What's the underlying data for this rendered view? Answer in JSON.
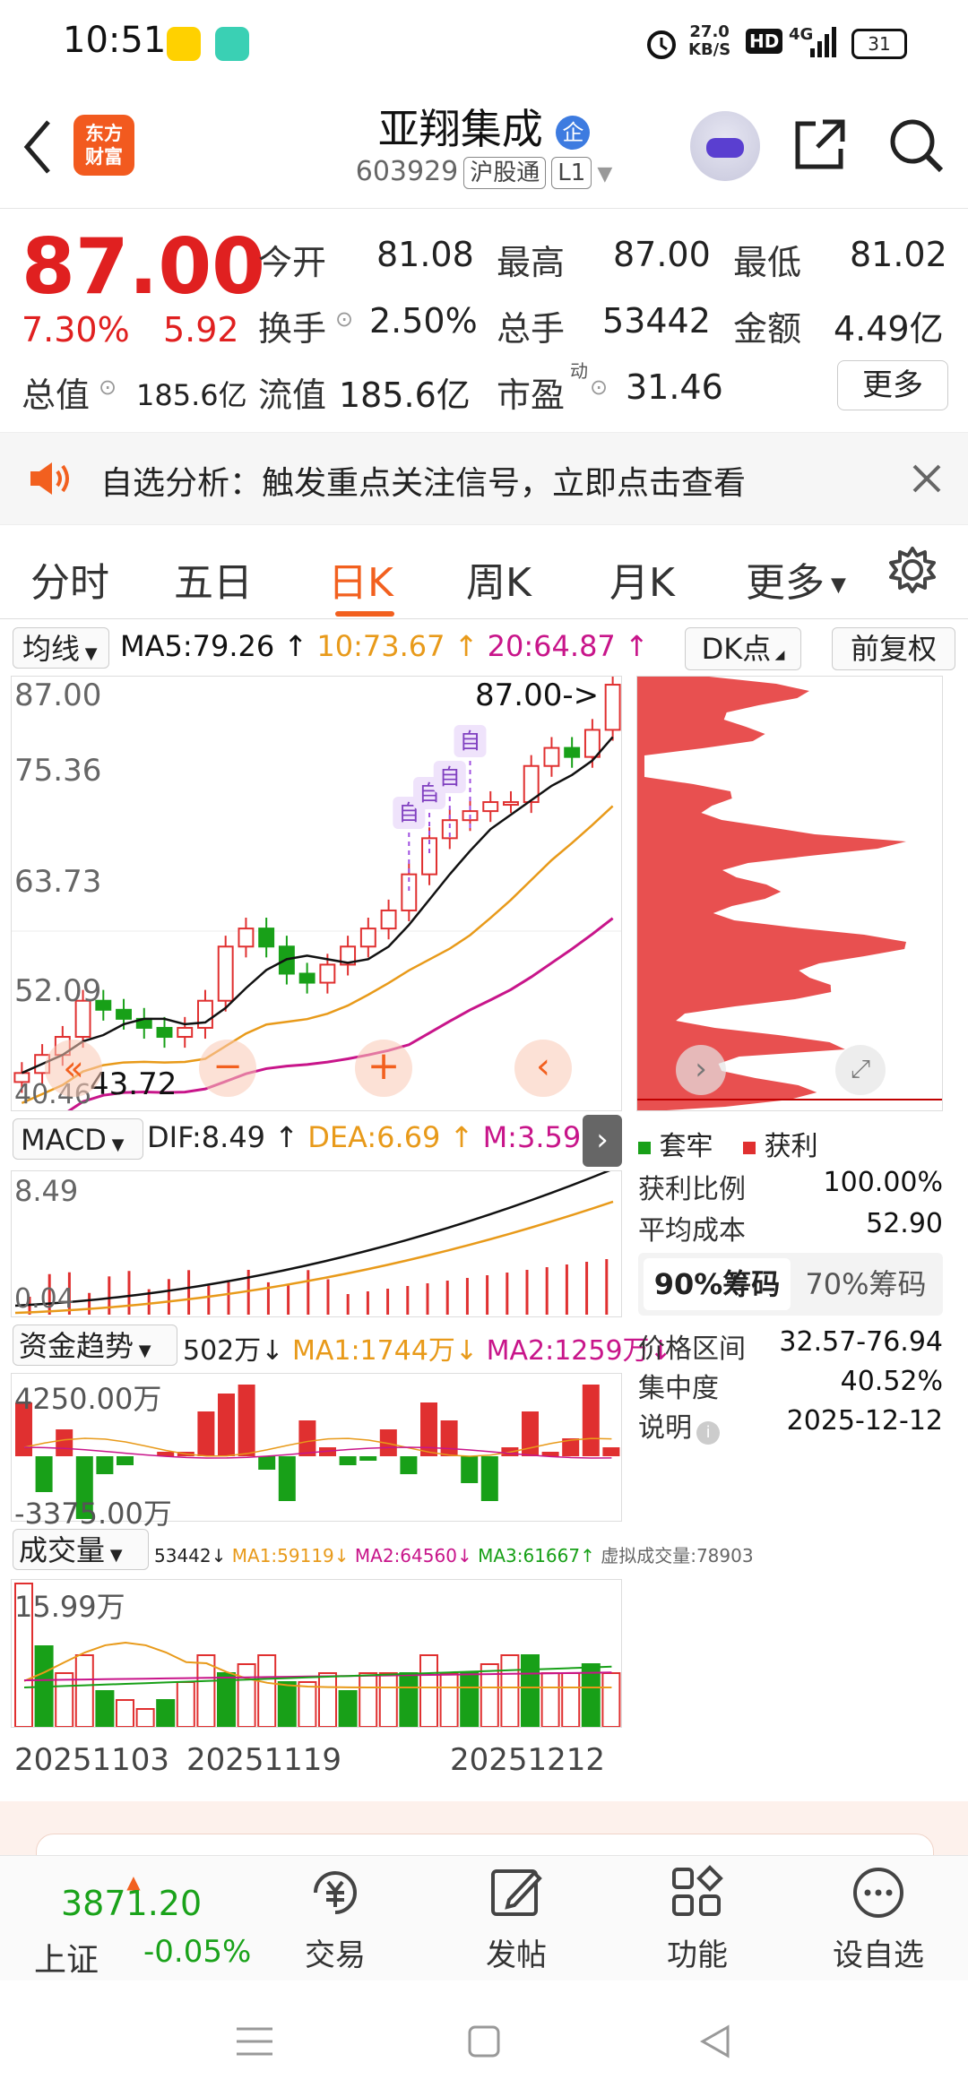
{
  "status": {
    "time": "10:51",
    "net_speed": "27.0\nKB/S",
    "net_speed_line1": "27.0",
    "net_speed_line2": "KB/S",
    "hd": "HD",
    "signal": "4G",
    "battery": "31"
  },
  "header": {
    "logo_line1": "东方",
    "logo_line2": "财富",
    "stock_name": "亚翔集成",
    "company_badge": "企",
    "code": "603929",
    "market": "沪股通",
    "level": "L1"
  },
  "quote": {
    "price": "87.00",
    "change_pct": "7.30%",
    "change_amt": "5.92",
    "open_label": "今开",
    "open": "81.08",
    "high_label": "最高",
    "high": "87.00",
    "low_label": "最低",
    "low": "81.02",
    "turnover_label": "换手",
    "turnover": "2.50%",
    "volume_label": "总手",
    "volume": "53442",
    "amount_label": "金额",
    "amount": "4.49亿",
    "mktcap_label": "总值",
    "mktcap": "185.6亿",
    "float_label": "流值",
    "float": "185.6亿",
    "pe_label": "市盈",
    "pe_sup": "动",
    "pe": "31.46",
    "more": "更多"
  },
  "notice": {
    "text": "自选分析：触发重点关注信号，立即点击查看"
  },
  "tabs": [
    "分时",
    "五日",
    "日K",
    "周K",
    "月K",
    "更多"
  ],
  "active_tab": "日K",
  "kline": {
    "ma_select": "均线",
    "ma5": "MA5:79.26",
    "ma10": "10:73.67",
    "ma20": "20:64.87",
    "dk_label": "DK点",
    "adjust_label": "前复权",
    "y_labels": [
      "87.00",
      "75.36",
      "63.73",
      "52.09",
      "40.46"
    ],
    "last_price_tag": "87.00->",
    "low_tag": "43.72",
    "self_marker": "自",
    "colors": {
      "up": "#e03030",
      "down": "#18a018",
      "ma5": "#111111",
      "ma10": "#e89a1a",
      "ma20": "#c8158a"
    }
  },
  "macd": {
    "select": "MACD",
    "dif": "DIF:8.49",
    "dea": "DEA:6.69",
    "m": "M:3.59",
    "y_top": "8.49",
    "y_bottom": "0.04"
  },
  "fund": {
    "select": "资金趋势",
    "val": "502万",
    "ma1": "MA1:1744万",
    "ma2": "MA2:1259万",
    "y_top": "4250.00万",
    "y_bottom": "-3375.00万"
  },
  "vol": {
    "select": "成交量",
    "val": "53442",
    "ma1": "MA1:59119",
    "ma2": "MA2:64560",
    "ma3": "MA3:61667",
    "virtual": "虚拟成交量:78903",
    "y_top": "15.99万"
  },
  "dates": [
    "20251103",
    "20251119",
    "20251212"
  ],
  "chips": {
    "legend_trap": "套牢",
    "legend_profit": "获利",
    "profit_ratio_label": "获利比例",
    "profit_ratio": "100.00%",
    "avg_cost_label": "平均成本",
    "avg_cost": "52.90",
    "tab90": "90%筹码",
    "tab70": "70%筹码",
    "range_label": "价格区间",
    "range": "32.57-76.94",
    "concentration_label": "集中度",
    "concentration": "40.52%",
    "note_label": "说明",
    "note": "2025-12-12"
  },
  "bottom_nav": {
    "index_value": "3871.20",
    "index_name": "上证",
    "index_change": "-0.05%",
    "items": [
      "交易",
      "发帖",
      "功能",
      "设自选"
    ]
  }
}
